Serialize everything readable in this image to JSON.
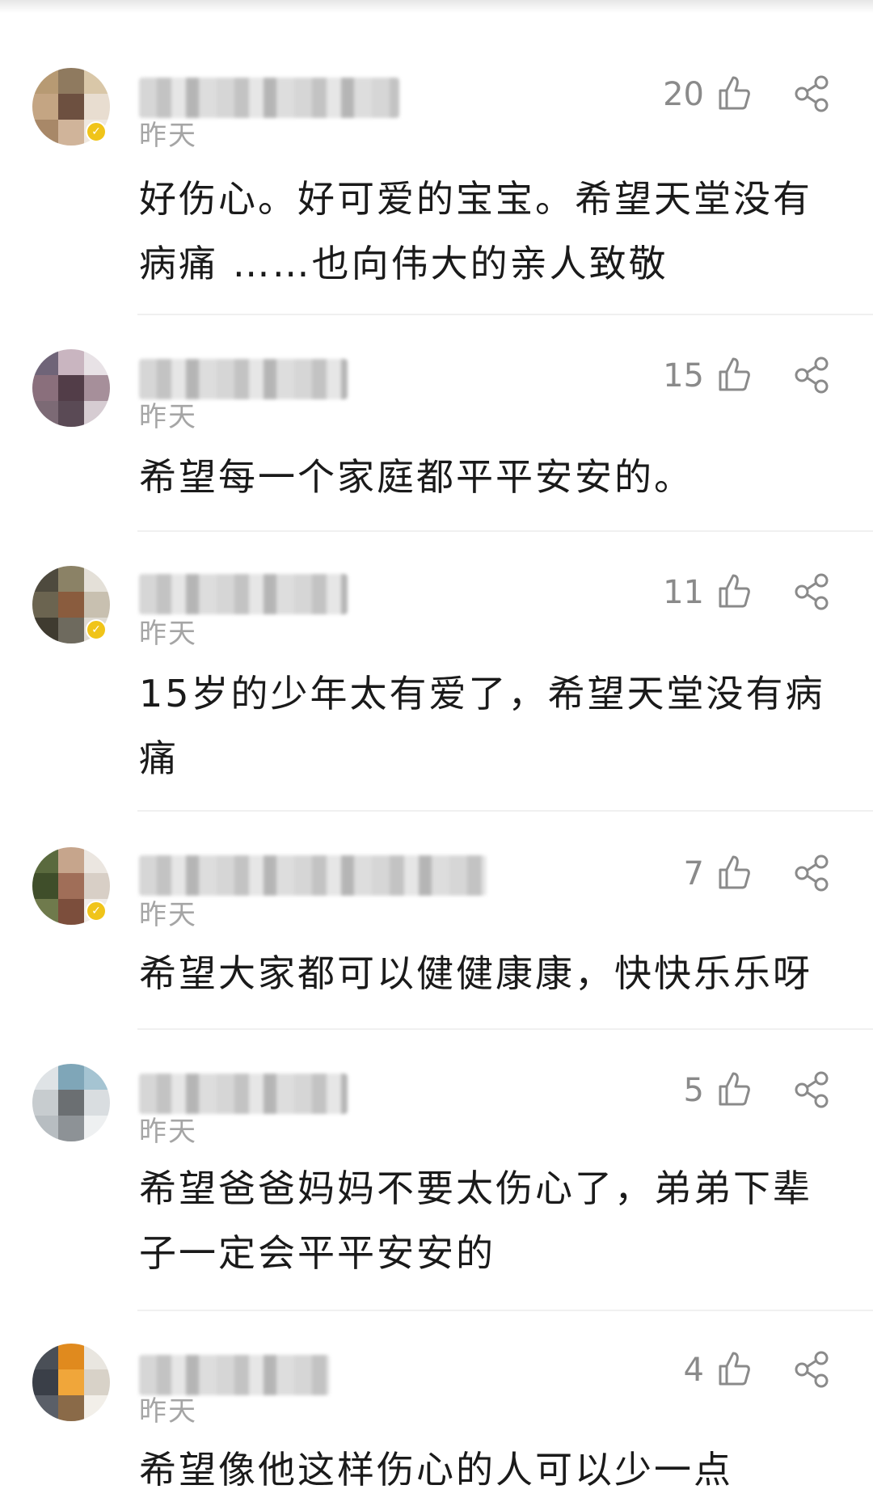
{
  "comments": [
    {
      "time": "昨天",
      "likes": "20",
      "text": "好伤心。好可爱的宝宝。希望天堂没有病痛 ……也向伟大的亲人致敬"
    },
    {
      "time": "昨天",
      "likes": "15",
      "text": "希望每一个家庭都平平安安的。"
    },
    {
      "time": "昨天",
      "likes": "11",
      "text": "15岁的少年太有爱了，希望天堂没有病痛"
    },
    {
      "time": "昨天",
      "likes": "7",
      "text": "希望大家都可以健健康康，快快乐乐呀"
    },
    {
      "time": "昨天",
      "likes": "5",
      "text": "希望爸爸妈妈不要太伤心了，弟弟下辈子一定会平平安安的"
    },
    {
      "time": "昨天",
      "likes": "4",
      "text": "希望像他这样伤心的人可以少一点"
    }
  ],
  "icons": {
    "like": "thumbs-up-icon",
    "share": "share-icon",
    "verified": "verified-badge-icon"
  },
  "colors": {
    "text": "#1a1a1a",
    "muted": "#a5a5a5",
    "count": "#8a8a8a",
    "badge": "#f0c419"
  }
}
